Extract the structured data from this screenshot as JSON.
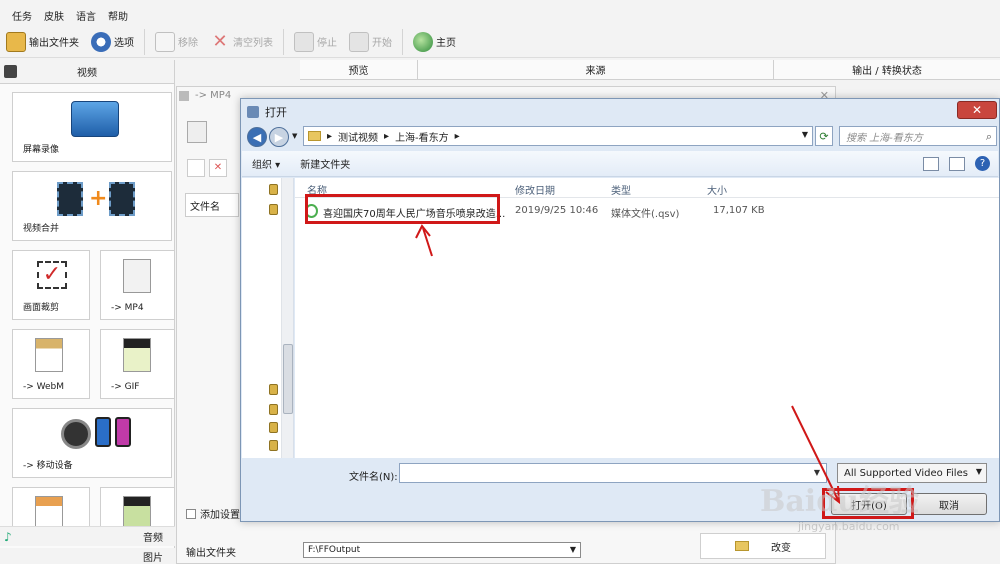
{
  "menu": [
    "任务",
    "皮肤",
    "语言",
    "帮助"
  ],
  "toolbar": {
    "output_folder": "输出文件夹",
    "options": "选项",
    "remove": "移除",
    "clear_list": "清空列表",
    "stop": "停止",
    "start": "开始",
    "home": "主页"
  },
  "left": {
    "header": "视频",
    "tiles": {
      "screen_record": "屏幕录像",
      "video_merge": "视频合并",
      "crop": "画面裁剪",
      "mp4": "-> MP4",
      "webm": "-> WebM",
      "gif": "-> GIF",
      "mobile": "-> 移动设备"
    },
    "footer_audio": "音频",
    "footer_image": "图片"
  },
  "columns": {
    "preview": "预览",
    "source": "来源",
    "output_status": "输出 / 转换状态"
  },
  "subdialog": {
    "title": "-> MP4",
    "filename_col": "文件名",
    "add_setting": "添加设置名",
    "output_folder_label": "输出文件夹",
    "output_path": "F:\\FFOutput",
    "change_button": "改变"
  },
  "open_dialog": {
    "title": "打开",
    "close": "✕",
    "path": [
      "测试视频",
      "上海-看东方"
    ],
    "search_placeholder": "搜索 上海-看东方",
    "organize": "组织 ▾",
    "new_folder": "新建文件夹",
    "headers": {
      "name": "名称",
      "modified": "修改日期",
      "type": "类型",
      "size": "大小"
    },
    "file": {
      "name": "喜迎国庆70周年人民广场音乐喷泉改造...",
      "modified": "2019/9/25 10:46",
      "type": "媒体文件(.qsv)",
      "size": "17,107 KB"
    },
    "filename_label": "文件名(N):",
    "filename_value": "",
    "filter": "All Supported Video Files",
    "open_button": "打开(O)",
    "cancel_button": "取消"
  },
  "watermark": {
    "logo": "Baidu经验",
    "url": "jingyan.baidu.com"
  }
}
